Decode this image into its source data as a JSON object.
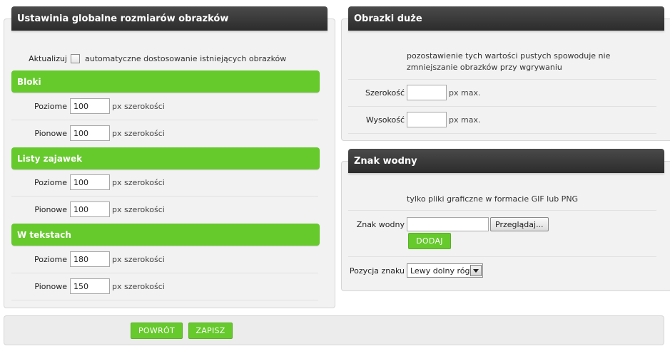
{
  "left_panel": {
    "title": "Ustawinia globalne rozmiarów obrazków",
    "update_label": "Aktualizuj",
    "update_checkbox_label": "automatyczne dostosowanie istniejących obrazków",
    "sections": [
      {
        "title": "Bloki",
        "rows": [
          {
            "label": "Poziome",
            "value": "100",
            "unit": "px szerokości"
          },
          {
            "label": "Pionowe",
            "value": "100",
            "unit": "px szerokości"
          }
        ]
      },
      {
        "title": "Listy zajawek",
        "rows": [
          {
            "label": "Poziome",
            "value": "100",
            "unit": "px szerokości"
          },
          {
            "label": "Pionowe",
            "value": "100",
            "unit": "px szerokości"
          }
        ]
      },
      {
        "title": "W tekstach",
        "rows": [
          {
            "label": "Poziome",
            "value": "180",
            "unit": "px szerokości"
          },
          {
            "label": "Pionowe",
            "value": "150",
            "unit": "px szerokości"
          }
        ]
      }
    ]
  },
  "large_images_panel": {
    "title": "Obrazki duże",
    "note": "pozostawienie tych wartości pustych spowoduje nie zmniejszanie obrazków przy wgrywaniu",
    "width_label": "Szerokość",
    "width_value": "",
    "width_unit": "px max.",
    "height_label": "Wysokość",
    "height_value": "",
    "height_unit": "px max."
  },
  "watermark_panel": {
    "title": "Znak wodny",
    "note": "tylko pliki graficzne w formacie GIF lub PNG",
    "file_label": "Znak wodny",
    "file_value": "",
    "browse_label": "Przeglądaj...",
    "add_label": "DODAJ",
    "position_label": "Pozycja znaku",
    "position_value": "Lewy dolny róg"
  },
  "footer": {
    "back_label": "POWRÓT",
    "save_label": "ZAPISZ"
  },
  "colors": {
    "accent_green": "#66c92c",
    "header_dark": "#333333",
    "panel_bg": "#f2f2f2"
  }
}
